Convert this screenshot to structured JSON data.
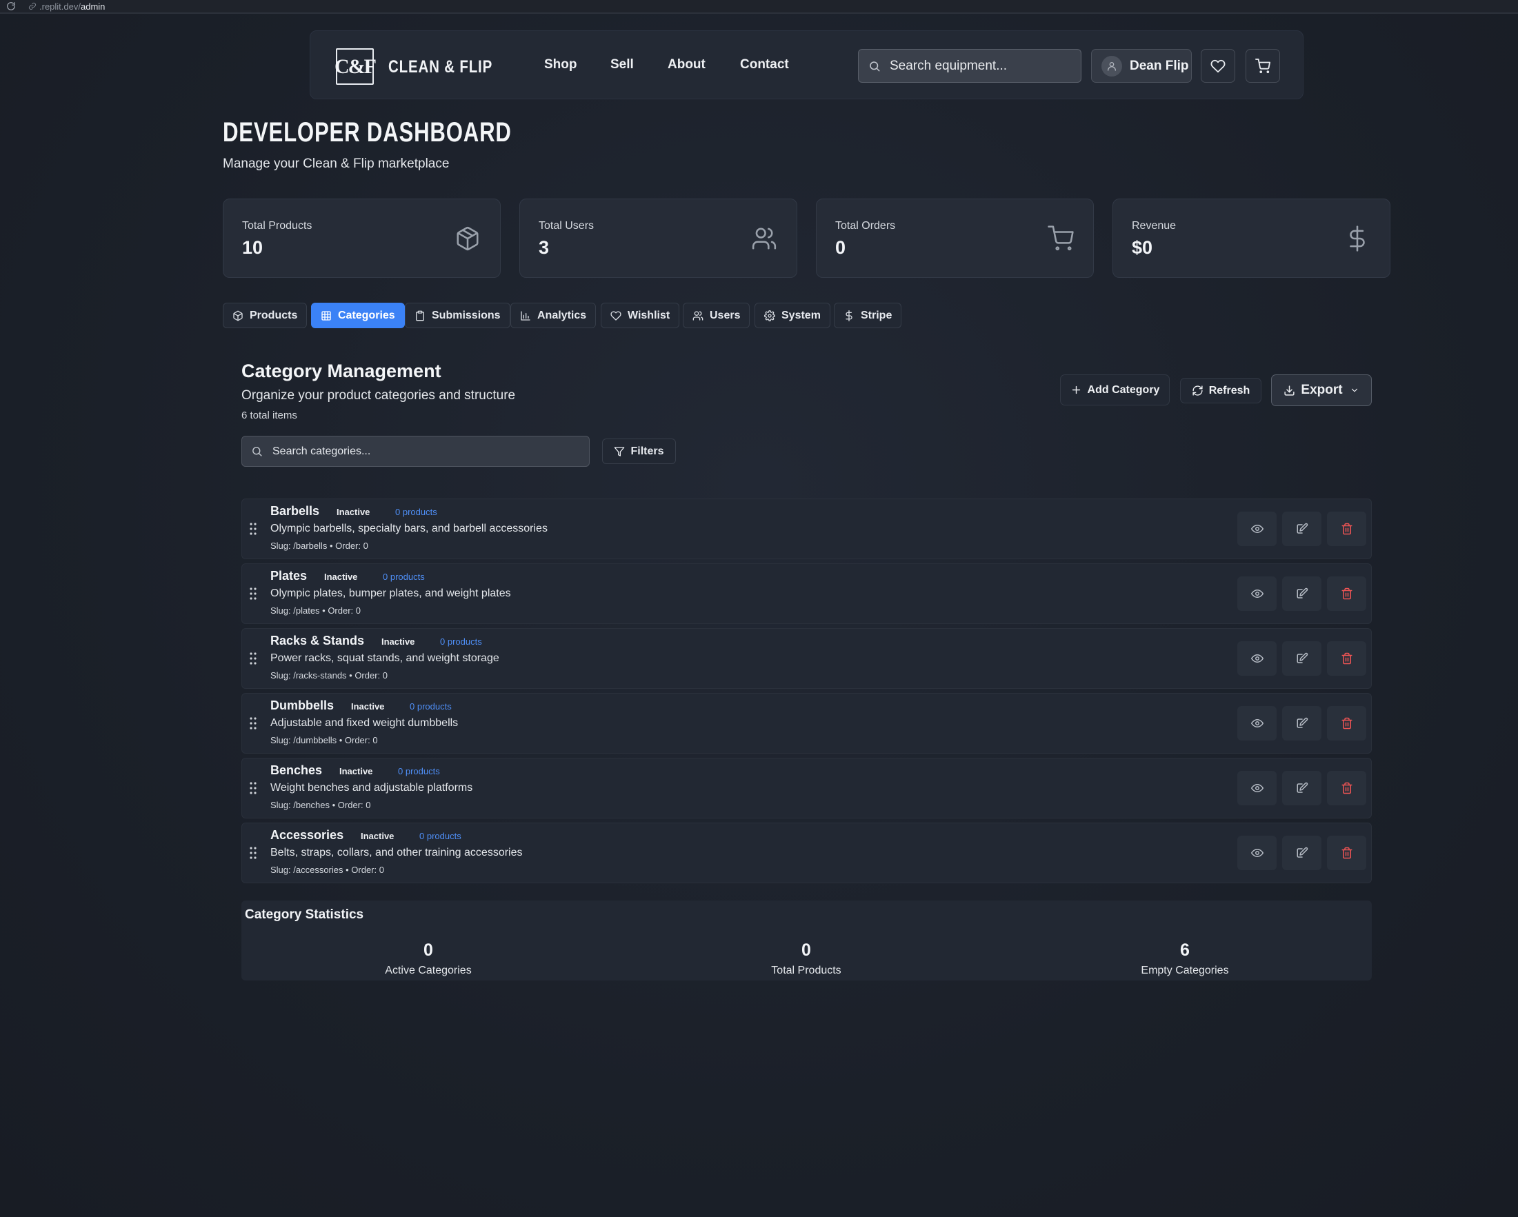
{
  "browser": {
    "url_prefix": ".replit.dev/",
    "url_path": "admin"
  },
  "header": {
    "logo": "C&F",
    "brand": "CLEAN & FLIP",
    "nav": [
      "Shop",
      "Sell",
      "About",
      "Contact"
    ],
    "search_placeholder": "Search equipment...",
    "user_name": "Dean Flip"
  },
  "page": {
    "title": "DEVELOPER DASHBOARD",
    "subtitle": "Manage your Clean & Flip marketplace"
  },
  "stats": [
    {
      "label": "Total Products",
      "value": "10",
      "icon": "box-icon"
    },
    {
      "label": "Total Users",
      "value": "3",
      "icon": "users-icon"
    },
    {
      "label": "Total Orders",
      "value": "0",
      "icon": "cart-icon"
    },
    {
      "label": "Revenue",
      "value": "$0",
      "icon": "dollar-icon"
    }
  ],
  "tabs": [
    {
      "label": "Products",
      "icon": "box-icon",
      "active": false
    },
    {
      "label": "Categories",
      "icon": "grid-icon",
      "active": true
    },
    {
      "label": "Submissions",
      "icon": "clipboard-icon",
      "active": false
    },
    {
      "label": "Analytics",
      "icon": "bar-chart-icon",
      "active": false
    },
    {
      "label": "Wishlist",
      "icon": "heart-icon",
      "active": false
    },
    {
      "label": "Users",
      "icon": "users-icon",
      "active": false
    },
    {
      "label": "System",
      "icon": "gear-icon",
      "active": false
    },
    {
      "label": "Stripe",
      "icon": "dollar-icon",
      "active": false
    }
  ],
  "management": {
    "title": "Category Management",
    "subtitle": "Organize your product categories and structure",
    "count": "6 total items",
    "add_label": "Add Category",
    "refresh_label": "Refresh",
    "export_label": "Export",
    "search_placeholder": "Search categories...",
    "filters_label": "Filters"
  },
  "categories": [
    {
      "name": "Barbells",
      "status": "Inactive",
      "products": "0 products",
      "description": "Olympic barbells, specialty bars, and barbell accessories",
      "meta": "Slug: /barbells • Order: 0"
    },
    {
      "name": "Plates",
      "status": "Inactive",
      "products": "0 products",
      "description": "Olympic plates, bumper plates, and weight plates",
      "meta": "Slug: /plates • Order: 0"
    },
    {
      "name": "Racks & Stands",
      "status": "Inactive",
      "products": "0 products",
      "description": "Power racks, squat stands, and weight storage",
      "meta": "Slug: /racks-stands • Order: 0"
    },
    {
      "name": "Dumbbells",
      "status": "Inactive",
      "products": "0 products",
      "description": "Adjustable and fixed weight dumbbells",
      "meta": "Slug: /dumbbells • Order: 0"
    },
    {
      "name": "Benches",
      "status": "Inactive",
      "products": "0 products",
      "description": "Weight benches and adjustable platforms",
      "meta": "Slug: /benches • Order: 0"
    },
    {
      "name": "Accessories",
      "status": "Inactive",
      "products": "0 products",
      "description": "Belts, straps, collars, and other training accessories",
      "meta": "Slug: /accessories • Order: 0"
    }
  ],
  "statistics": {
    "title": "Category Statistics",
    "items": [
      {
        "value": "0",
        "label": "Active Categories"
      },
      {
        "value": "0",
        "label": "Total Products"
      },
      {
        "value": "6",
        "label": "Empty Categories"
      }
    ]
  },
  "colors": {
    "accent": "#3b82f6",
    "danger": "#ef5454",
    "link": "#4f8ff7"
  }
}
